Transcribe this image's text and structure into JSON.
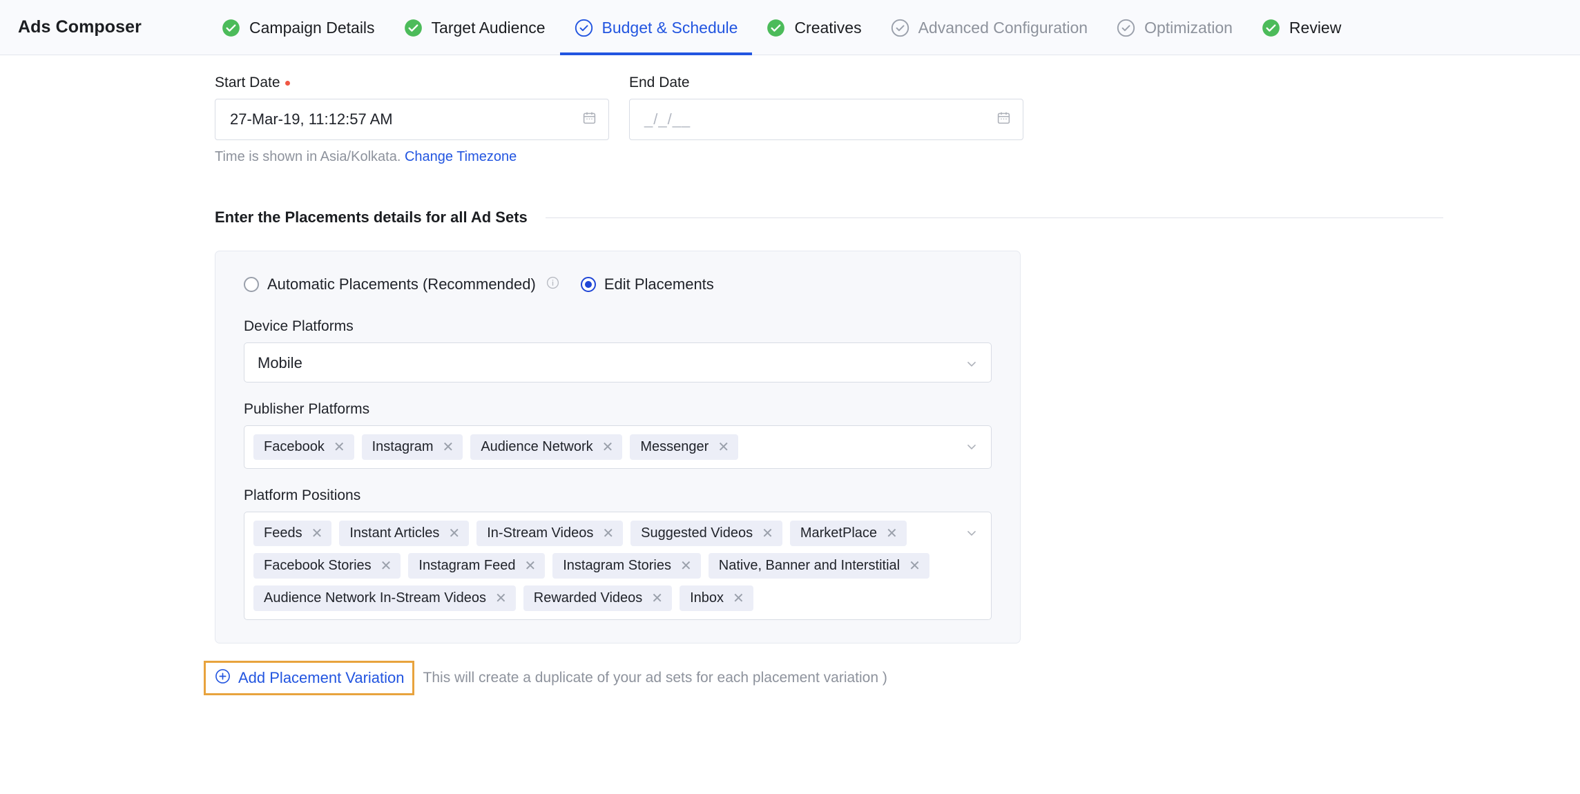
{
  "app": {
    "title": "Ads Composer"
  },
  "nav": {
    "tabs": [
      {
        "label": "Campaign Details",
        "state": "complete"
      },
      {
        "label": "Target Audience",
        "state": "complete"
      },
      {
        "label": "Budget & Schedule",
        "state": "active"
      },
      {
        "label": "Creatives",
        "state": "complete"
      },
      {
        "label": "Advanced Configuration",
        "state": "pending"
      },
      {
        "label": "Optimization",
        "state": "pending"
      },
      {
        "label": "Review",
        "state": "complete"
      }
    ]
  },
  "schedule": {
    "start_date": {
      "label": "Start Date",
      "value": "27-Mar-19, 11:12:57 AM",
      "required": true,
      "icon": "calendar-icon"
    },
    "end_date": {
      "label": "End Date",
      "value": "",
      "placeholder": "_/_/__",
      "required": false,
      "icon": "calendar-icon"
    },
    "timezone_note": "Time is shown in Asia/Kolkata.",
    "timezone_link": "Change Timezone"
  },
  "placements": {
    "section_title": "Enter the Placements details for all Ad Sets",
    "options": [
      {
        "label": "Automatic Placements (Recommended)",
        "selected": false,
        "info": true
      },
      {
        "label": "Edit Placements",
        "selected": true,
        "info": false
      }
    ],
    "device_platforms": {
      "label": "Device Platforms",
      "value": "Mobile"
    },
    "publisher_platforms": {
      "label": "Publisher Platforms",
      "chips": [
        "Facebook",
        "Instagram",
        "Audience Network",
        "Messenger"
      ]
    },
    "platform_positions": {
      "label": "Platform Positions",
      "chips": [
        "Feeds",
        "Instant Articles",
        "In-Stream Videos",
        "Suggested Videos",
        "MarketPlace",
        "Facebook Stories",
        "Instagram Feed",
        "Instagram Stories",
        "Native, Banner and Interstitial",
        "Audience Network In-Stream Videos",
        "Rewarded Videos",
        "Inbox"
      ]
    },
    "add_variation": {
      "label": "Add Placement Variation",
      "icon": "plus-circle-icon",
      "note": "This will create a duplicate of your ad sets for each placement variation )",
      "highlight_color": "#e8a33d"
    }
  },
  "colors": {
    "accent_blue": "#2255e0",
    "complete_green": "#4cbb5a",
    "pending_gray": "#8d929c",
    "required_red": "#f05744",
    "highlight_amber": "#e8a33d"
  }
}
